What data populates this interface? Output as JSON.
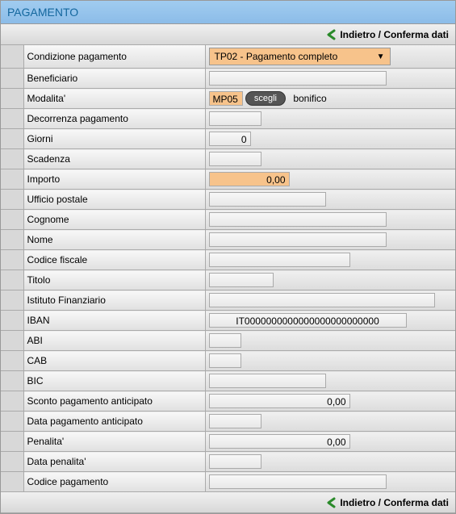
{
  "header": {
    "title": "PAGAMENTO"
  },
  "toolbar": {
    "back_confirm": "Indietro / Conferma dati"
  },
  "fields": {
    "condizione_pagamento": {
      "label": "Condizione pagamento",
      "value": "TP02 - Pagamento completo"
    },
    "beneficiario": {
      "label": "Beneficiario",
      "value": ""
    },
    "modalita": {
      "label": "Modalita'",
      "code": "MP05",
      "btn": "scegli",
      "text": "bonifico"
    },
    "decorrenza": {
      "label": "Decorrenza pagamento",
      "value": ""
    },
    "giorni": {
      "label": "Giorni",
      "value": "0"
    },
    "scadenza": {
      "label": "Scadenza",
      "value": ""
    },
    "importo": {
      "label": "Importo",
      "value": "0,00"
    },
    "ufficio_postale": {
      "label": "Ufficio postale",
      "value": ""
    },
    "cognome": {
      "label": "Cognome",
      "value": ""
    },
    "nome": {
      "label": "Nome",
      "value": ""
    },
    "codice_fiscale": {
      "label": "Codice fiscale",
      "value": ""
    },
    "titolo": {
      "label": "Titolo",
      "value": ""
    },
    "istituto": {
      "label": "Istituto Finanziario",
      "value": ""
    },
    "iban": {
      "label": "IBAN",
      "value": "IT0000000000000000000000000"
    },
    "abi": {
      "label": "ABI",
      "value": ""
    },
    "cab": {
      "label": "CAB",
      "value": ""
    },
    "bic": {
      "label": "BIC",
      "value": ""
    },
    "sconto": {
      "label": "Sconto pagamento anticipato",
      "value": "0,00"
    },
    "data_anticipato": {
      "label": "Data pagamento anticipato",
      "value": ""
    },
    "penalita": {
      "label": "Penalita'",
      "value": "0,00"
    },
    "data_penalita": {
      "label": "Data penalita'",
      "value": ""
    },
    "codice_pagamento": {
      "label": "Codice pagamento",
      "value": ""
    }
  }
}
